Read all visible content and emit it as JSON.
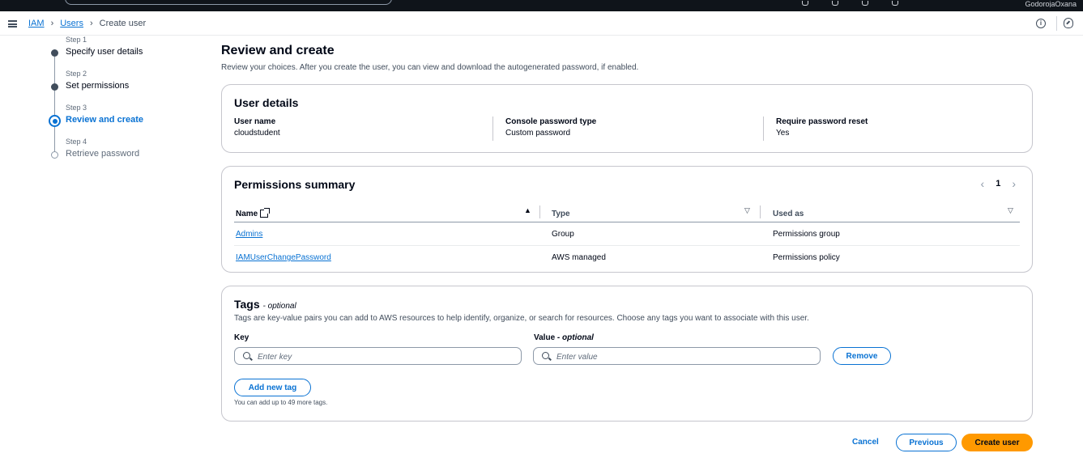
{
  "topbar": {
    "user": "GodorojaOxana"
  },
  "breadcrumb": {
    "items": [
      "IAM",
      "Users"
    ],
    "current": "Create user"
  },
  "steps": [
    {
      "number": "Step 1",
      "label": "Specify user details",
      "state": "done"
    },
    {
      "number": "Step 2",
      "label": "Set permissions",
      "state": "done"
    },
    {
      "number": "Step 3",
      "label": "Review and create",
      "state": "active"
    },
    {
      "number": "Step 4",
      "label": "Retrieve password",
      "state": "pending"
    }
  ],
  "page": {
    "title": "Review and create",
    "description": "Review your choices. After you create the user, you can view and download the autogenerated password, if enabled."
  },
  "user_details": {
    "title": "User details",
    "fields": [
      {
        "key": "User name",
        "value": "cloudstudent"
      },
      {
        "key": "Console password type",
        "value": "Custom password"
      },
      {
        "key": "Require password reset",
        "value": "Yes"
      }
    ]
  },
  "permissions": {
    "title": "Permissions summary",
    "page": "1",
    "columns": [
      "Name",
      "Type",
      "Used as"
    ],
    "rows": [
      {
        "name": "Admins",
        "type": "Group",
        "used_as": "Permissions group"
      },
      {
        "name": "IAMUserChangePassword",
        "type": "AWS managed",
        "used_as": "Permissions policy"
      }
    ]
  },
  "tags": {
    "title": "Tags",
    "title_suffix": "- optional",
    "description": "Tags are key-value pairs you can add to AWS resources to help identify, organize, or search for resources. Choose any tags you want to associate with this user.",
    "key_label": "Key",
    "value_label": "Value",
    "value_label_suffix": "- optional",
    "key_placeholder": "Enter key",
    "value_placeholder": "Enter value",
    "remove_label": "Remove",
    "add_label": "Add new tag",
    "helper": "You can add up to 49 more tags."
  },
  "footer": {
    "cancel": "Cancel",
    "previous": "Previous",
    "create": "Create user"
  },
  "colors": {
    "accent": "#0972d3",
    "primary_button": "#ff9900"
  }
}
